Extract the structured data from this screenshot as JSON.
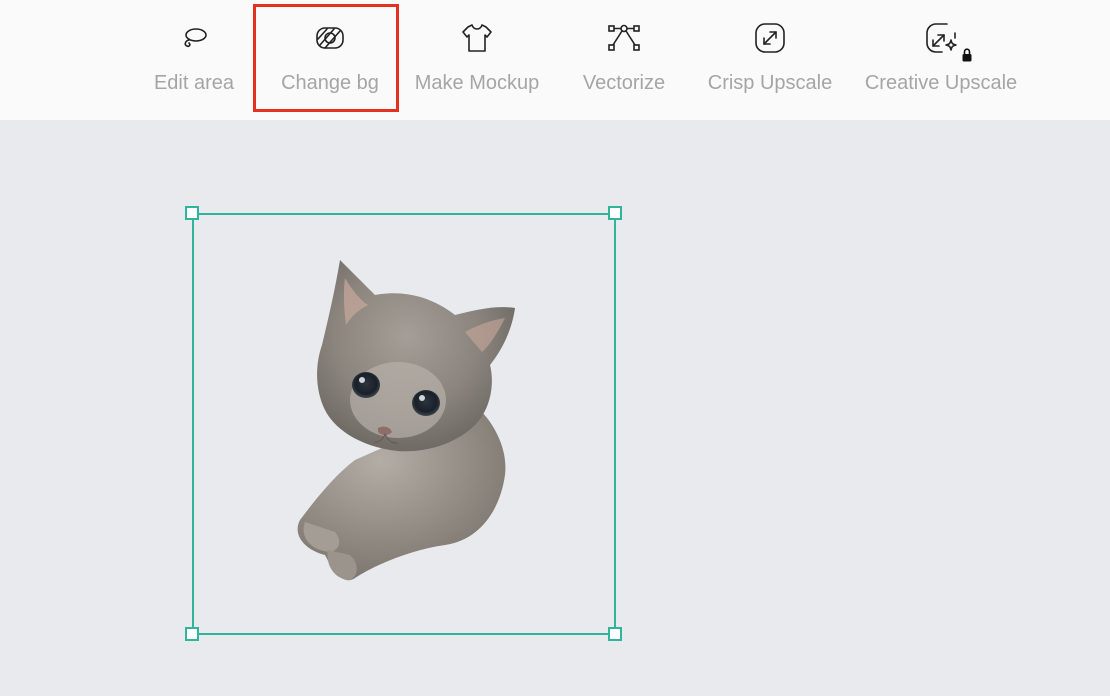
{
  "toolbar": {
    "tools": [
      {
        "label": "Edit area",
        "icon": "lasso-icon"
      },
      {
        "label": "Change bg",
        "icon": "change-background-icon"
      },
      {
        "label": "Make Mockup",
        "icon": "tshirt-icon"
      },
      {
        "label": "Vectorize",
        "icon": "vector-path-icon"
      },
      {
        "label": "Crisp Upscale",
        "icon": "expand-arrows-icon"
      },
      {
        "label": "Creative Upscale",
        "icon": "expand-sparkle-icon"
      }
    ],
    "highlighted_tool": "Change bg",
    "locked_tool": "Creative Upscale"
  },
  "canvas": {
    "subject": "kitten-image",
    "selection_color": "#31b49c",
    "background_color": "#e9eaee"
  },
  "colors": {
    "highlight_border": "#e5301f",
    "label_gray": "#a5a5a5"
  }
}
